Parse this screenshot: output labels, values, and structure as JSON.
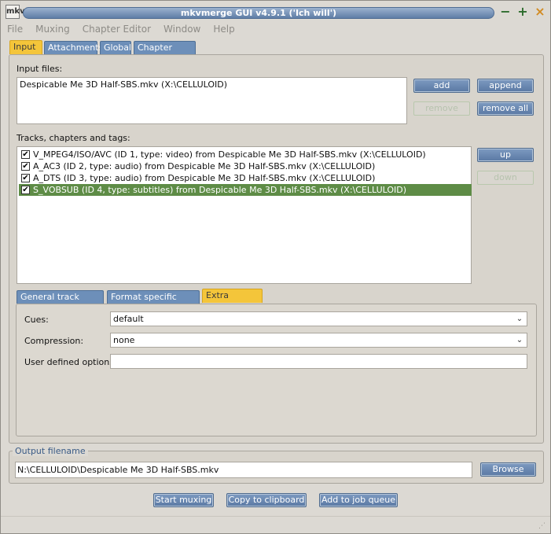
{
  "window": {
    "title": "mkvmerge GUI v4.9.1 ('Ich will')",
    "icon_label": "mkv",
    "controls": {
      "minimize": "−",
      "maximize": "+",
      "close": "×"
    }
  },
  "menu": [
    "File",
    "Muxing",
    "Chapter Editor",
    "Window",
    "Help"
  ],
  "tabs": [
    "Input",
    "Attachments",
    "Global",
    "Chapter Editor"
  ],
  "input": {
    "files_label": "Input files:",
    "files": [
      "Despicable Me 3D Half-SBS.mkv (X:\\CELLULOID)"
    ],
    "buttons": {
      "add": "add",
      "append": "append",
      "remove": "remove",
      "remove_all": "remove all"
    },
    "tracks_label": "Tracks, chapters and tags:",
    "tracks": [
      {
        "checked": true,
        "text": "V_MPEG4/ISO/AVC (ID 1, type: video) from Despicable Me 3D Half-SBS.mkv (X:\\CELLULOID)",
        "selected": false
      },
      {
        "checked": true,
        "text": "A_AC3 (ID 2, type: audio) from Despicable Me 3D Half-SBS.mkv (X:\\CELLULOID)",
        "selected": false
      },
      {
        "checked": true,
        "text": "A_DTS (ID 3, type: audio) from Despicable Me 3D Half-SBS.mkv (X:\\CELLULOID)",
        "selected": false
      },
      {
        "checked": true,
        "text": "S_VOBSUB (ID 4, type: subtitles) from Despicable Me 3D Half-SBS.mkv (X:\\CELLULOID)",
        "selected": true
      }
    ],
    "track_buttons": {
      "up": "up",
      "down": "down"
    },
    "subtabs": [
      "General track options",
      "Format specific options",
      "Extra options"
    ],
    "extra": {
      "cues_label": "Cues:",
      "cues_value": "default",
      "compression_label": "Compression:",
      "compression_value": "none",
      "user_label": "User defined options:",
      "user_value": ""
    }
  },
  "output": {
    "label": "Output filename",
    "value": "N:\\CELLULOID\\Despicable Me 3D Half-SBS.mkv",
    "browse": "Browse"
  },
  "actions": {
    "start": "Start muxing",
    "copy": "Copy to clipboard",
    "queue": "Add to job queue"
  },
  "checkmark": "✔",
  "dropdown_glyph": "⌄",
  "colors": {
    "active_tab": "#f4c53a",
    "tab": "#6d8fb9",
    "selected_row": "#5e8c46",
    "button": "#5a79a3"
  }
}
